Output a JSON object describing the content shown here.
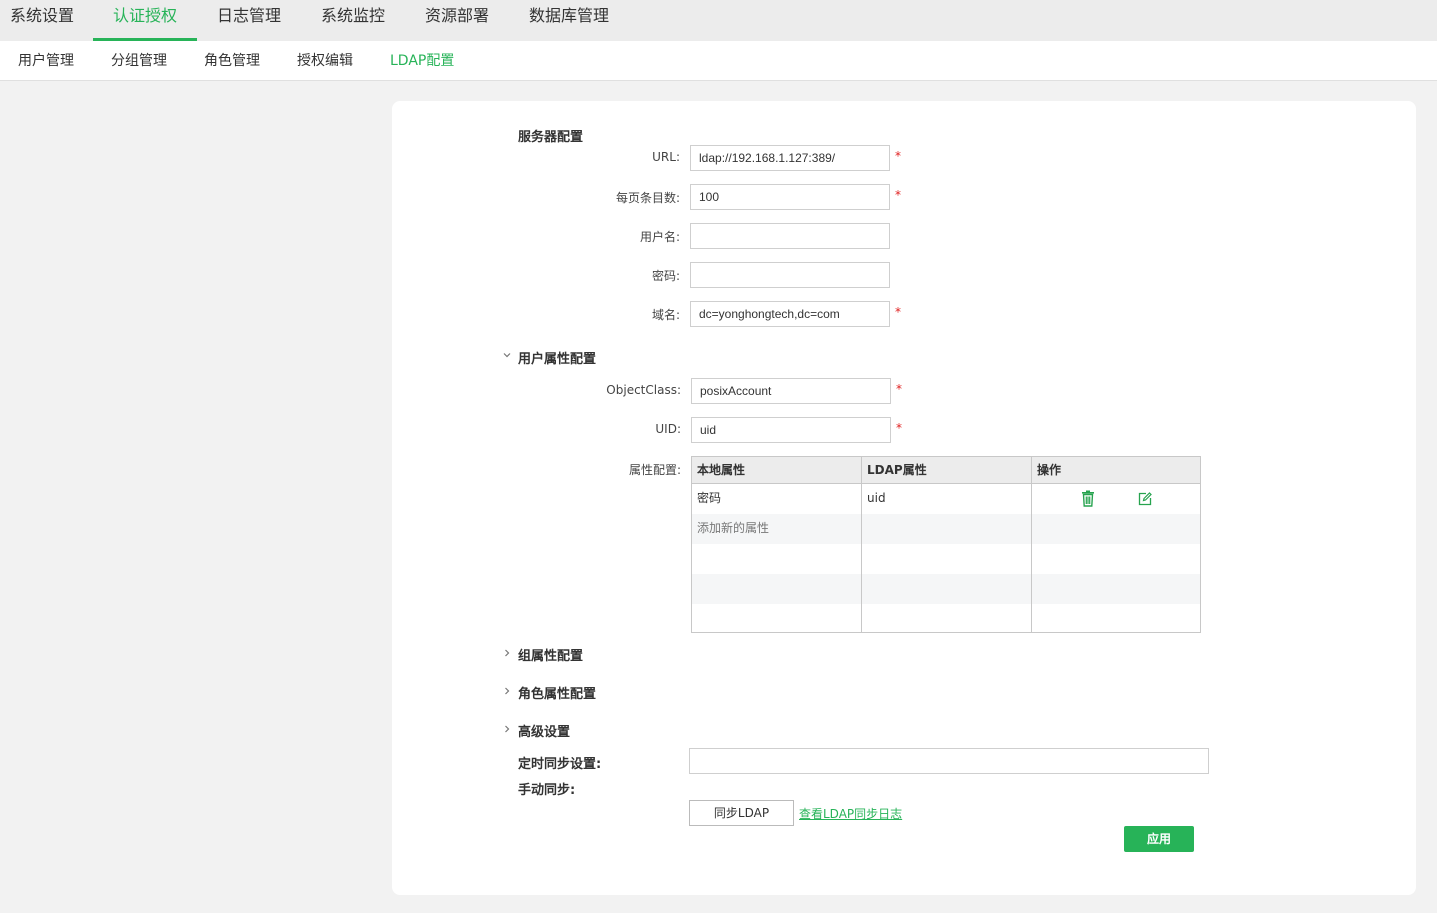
{
  "top_nav": {
    "tabs": [
      {
        "label": "系统设置"
      },
      {
        "label": "认证授权"
      },
      {
        "label": "日志管理"
      },
      {
        "label": "系统监控"
      },
      {
        "label": "资源部署"
      },
      {
        "label": "数据库管理"
      }
    ],
    "active_index": 1
  },
  "sub_nav": {
    "tabs": [
      {
        "label": "用户管理"
      },
      {
        "label": "分组管理"
      },
      {
        "label": "角色管理"
      },
      {
        "label": "授权编辑"
      },
      {
        "label": "LDAP配置"
      }
    ],
    "active_index": 4
  },
  "server": {
    "title": "服务器配置",
    "url_label": "URL:",
    "url_value": "ldap://192.168.1.127:389/",
    "page_size_label": "每页条目数:",
    "page_size_value": "100",
    "username_label": "用户名:",
    "username_value": "",
    "password_label": "密码:",
    "password_value": "",
    "domain_label": "域名:",
    "domain_value": "dc=yonghongtech,dc=com",
    "required_mark": "*"
  },
  "user_attr": {
    "title": "用户属性配置",
    "objectclass_label": "ObjectClass:",
    "objectclass_value": "posixAccount",
    "uid_label": "UID:",
    "uid_value": "uid",
    "attr_label": "属性配置:",
    "table": {
      "headers": [
        "本地属性",
        "LDAP属性",
        "操作"
      ],
      "rows": [
        {
          "local": "密码",
          "ldap": "uid"
        }
      ],
      "add_placeholder": "添加新的属性"
    }
  },
  "group_attr": {
    "title": "组属性配置"
  },
  "role_attr": {
    "title": "角色属性配置"
  },
  "advanced": {
    "title": "高级设置",
    "schedule_label": "定时同步设置:",
    "schedule_value": "",
    "manual_label": "手动同步:",
    "sync_button": "同步LDAP",
    "log_link": "查看LDAP同步日志"
  },
  "apply_button": "应用",
  "colors": {
    "accent": "#27b358",
    "required": "#e02020"
  },
  "icons": {
    "delete": "trash-icon",
    "edit": "edit-icon",
    "expanded": "chevron-down-icon",
    "collapsed": "chevron-right-icon"
  }
}
